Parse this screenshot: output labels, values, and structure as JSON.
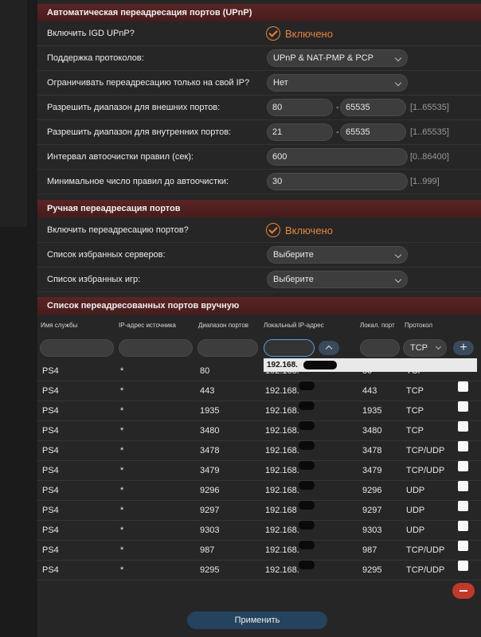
{
  "upnp": {
    "title": "Автоматическая переадресация портов (UPnP)",
    "enable_label": "Включить IGD UPnP?",
    "enable_value": "Включено",
    "protocols_label": "Поддержка протоколов:",
    "protocols_value": "UPnP & NAT-PMP & PCP",
    "restrict_label": "Ограничивать переадресацию только на свой IP?",
    "restrict_value": "Нет",
    "ext_label": "Разрешить диапазон для внешних портов:",
    "ext_from": "80",
    "ext_to": "65535",
    "ext_hint": "[1..65535]",
    "int_label": "Разрешить диапазон для внутренних портов:",
    "int_from": "21",
    "int_to": "65535",
    "int_hint": "[1..65535]",
    "cleanup_label": "Интервал автоочистки правил (сек):",
    "cleanup_value": "600",
    "cleanup_hint": "[0..86400]",
    "minrules_label": "Минимальное число правил до автоочистки:",
    "minrules_value": "30",
    "minrules_hint": "[1..999]",
    "dash": "-"
  },
  "manual": {
    "title": "Ручная переадресация портов",
    "enable_label": "Включить переадресацию портов?",
    "enable_value": "Включено",
    "servers_label": "Список избранных серверов:",
    "servers_value": "Выберите",
    "games_label": "Список избранных игр:",
    "games_value": "Выберите"
  },
  "list": {
    "title": "Список переадресованных портов вручную",
    "headers": {
      "name": "Имя службы",
      "src": "IP-адрес источника",
      "range": "Диапазон портов",
      "ip": "Локальный IP-адрес",
      "lport": "Локал. порт",
      "proto": "Протокол"
    },
    "proto_filter": "TCP",
    "autocomplete": "192.168.",
    "rows": [
      {
        "name": "PS4",
        "src": "*",
        "range": "80",
        "ip": "192.168.",
        "lport": "80",
        "proto": "TCP"
      },
      {
        "name": "PS4",
        "src": "*",
        "range": "443",
        "ip": "192.168.",
        "lport": "443",
        "proto": "TCP"
      },
      {
        "name": "PS4",
        "src": "*",
        "range": "1935",
        "ip": "192.168.",
        "lport": "1935",
        "proto": "TCP"
      },
      {
        "name": "PS4",
        "src": "*",
        "range": "3480",
        "ip": "192.168.",
        "lport": "3480",
        "proto": "TCP"
      },
      {
        "name": "PS4",
        "src": "*",
        "range": "3478",
        "ip": "192.168.",
        "lport": "3478",
        "proto": "TCP/UDP"
      },
      {
        "name": "PS4",
        "src": "*",
        "range": "3479",
        "ip": "192.168.",
        "lport": "3479",
        "proto": "TCP/UDP"
      },
      {
        "name": "PS4",
        "src": "*",
        "range": "9296",
        "ip": "192.168.",
        "lport": "9296",
        "proto": "UDP"
      },
      {
        "name": "PS4",
        "src": "*",
        "range": "9297",
        "ip": "192.168",
        "lport": "9297",
        "proto": "UDP"
      },
      {
        "name": "PS4",
        "src": "*",
        "range": "9303",
        "ip": "192.168.",
        "lport": "9303",
        "proto": "UDP"
      },
      {
        "name": "PS4",
        "src": "*",
        "range": "987",
        "ip": "192.168.",
        "lport": "987",
        "proto": "TCP/UDP"
      },
      {
        "name": "PS4",
        "src": "*",
        "range": "9295",
        "ip": "192.168.",
        "lport": "9295",
        "proto": "TCP/UDP"
      }
    ]
  },
  "apply_label": "Применить"
}
